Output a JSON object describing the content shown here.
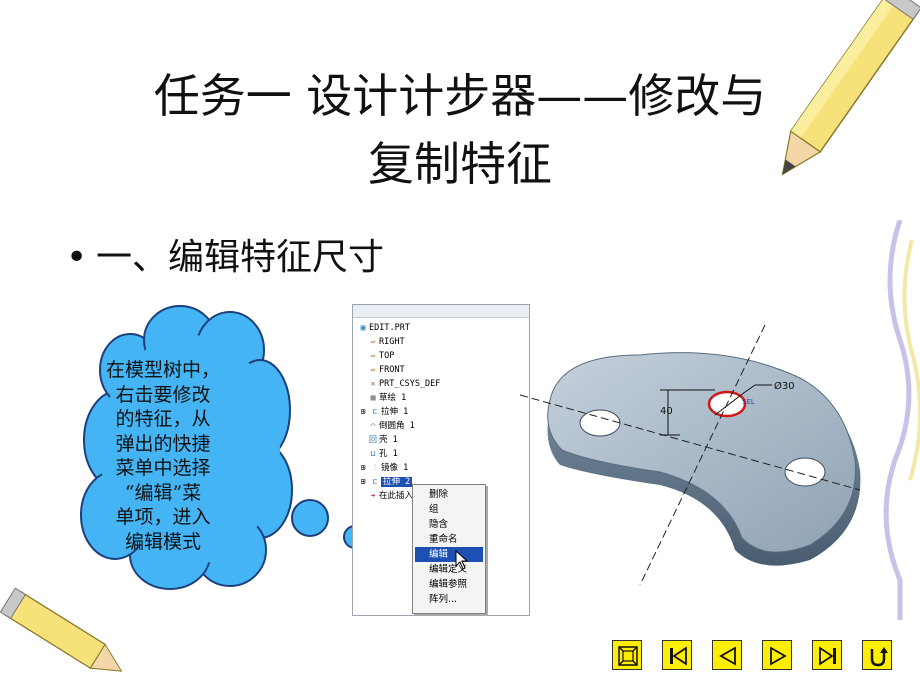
{
  "slide": {
    "title_line1": "任务一  设计计步器——修改与",
    "title_line2": "复制特征",
    "bullet": "一、编辑特征尺寸",
    "callout_lines": [
      "在模型树中，",
      "右击要修改",
      "的特征，从",
      "弹出的快捷",
      "菜单中选择",
      "“编辑”菜",
      "单项，进入",
      "编辑模式"
    ]
  },
  "model_tree": {
    "root": "EDIT.PRT",
    "items": [
      {
        "label": "RIGHT",
        "icon": "datum-plane-icon"
      },
      {
        "label": "TOP",
        "icon": "datum-plane-icon"
      },
      {
        "label": "FRONT",
        "icon": "datum-plane-icon"
      },
      {
        "label": "PRT_CSYS_DEF",
        "icon": "csys-icon"
      },
      {
        "label": "草绘 1",
        "icon": "sketch-icon"
      },
      {
        "label": "拉伸 1",
        "icon": "extrude-icon"
      },
      {
        "label": "倒圆角 1",
        "icon": "round-icon"
      },
      {
        "label": "壳 1",
        "icon": "shell-icon"
      },
      {
        "label": "孔 1",
        "icon": "hole-icon"
      },
      {
        "label": "镜像 1",
        "icon": "mirror-icon"
      },
      {
        "label": "拉伸 2",
        "icon": "extrude-icon"
      },
      {
        "label": "在此插入",
        "icon": "insert-arrow-icon"
      }
    ]
  },
  "context_menu": {
    "items": [
      "删除",
      "组",
      "隐含",
      "重命名",
      "编辑",
      "编辑定义",
      "编辑参照",
      "阵列..."
    ],
    "selected": "编辑"
  },
  "model_view": {
    "dim_diameter": "Ø30",
    "dim_height": "40",
    "hole_tag": "SEL"
  },
  "nav": {
    "buttons": [
      "home",
      "first",
      "prev",
      "next",
      "last",
      "return"
    ],
    "color": "#ffee00"
  },
  "colors": {
    "cloud": "#44b4f4",
    "part": "#9fb0c0"
  }
}
